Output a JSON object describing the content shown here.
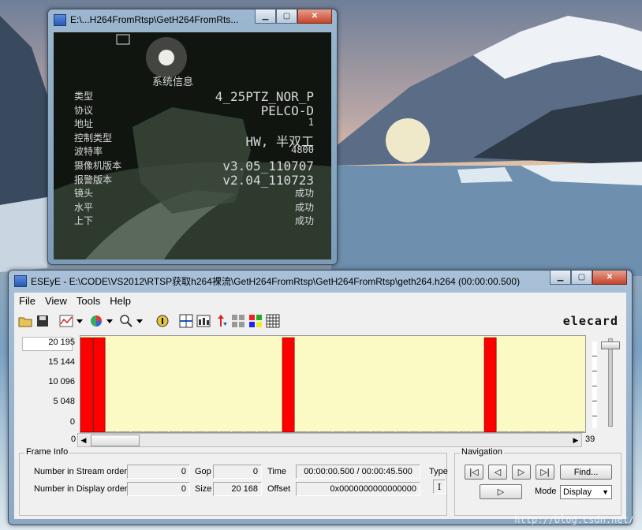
{
  "video_window": {
    "title": "E:\\...H264FromRtsp\\GetH264FromRts...",
    "osd": {
      "header": "系统信息",
      "rows": [
        {
          "label": "类型",
          "value": "4_25PTZ_NOR_P"
        },
        {
          "label": "协议",
          "value": "PELCO-D"
        },
        {
          "label": "地址",
          "value": "1"
        },
        {
          "label": "控制类型",
          "value": "HW, 半双工"
        },
        {
          "label": "波特率",
          "value": "4800"
        },
        {
          "label": "摄像机版本",
          "value": "v3.05_110707"
        },
        {
          "label": "报警版本",
          "value": "v2.04_110723"
        },
        {
          "label": "镜头",
          "value": "成功"
        },
        {
          "label": "水平",
          "value": "成功"
        },
        {
          "label": "上下",
          "value": "成功"
        }
      ]
    }
  },
  "eseye": {
    "title": "ESEyE - E:\\CODE\\VS2012\\RTSP获取h264裸流\\GetH264FromRtsp\\GetH264FromRtsp\\geth264.h264 (00:00:00.500)",
    "menu": [
      "File",
      "View",
      "Tools",
      "Help"
    ],
    "logo": "elecard",
    "chart_data": {
      "type": "bar",
      "y_ticks": [
        "20 195",
        "15 144",
        "10 096",
        "5 048",
        "0"
      ],
      "ylim": [
        0,
        20195
      ],
      "x_start": "0",
      "x_end": "39",
      "bar_color": "#ff0000",
      "values": [
        20168,
        20168,
        100,
        100,
        100,
        100,
        100,
        100,
        100,
        100,
        100,
        100,
        100,
        100,
        100,
        100,
        20168,
        100,
        100,
        100,
        100,
        100,
        100,
        100,
        100,
        100,
        100,
        100,
        100,
        100,
        100,
        100,
        20168,
        100,
        100,
        100,
        100,
        100,
        100,
        100
      ]
    },
    "frame_info": {
      "group_label": "Frame Info",
      "stream_order_label": "Number in Stream order",
      "stream_order": "0",
      "display_order_label": "Number in Display order",
      "display_order": "0",
      "gop_label": "Gop",
      "gop": "0",
      "size_label": "Size",
      "size": "20 168",
      "time_label": "Time",
      "time": "00:00:00.500 / 00:00:45.500",
      "offset_label": "Offset",
      "offset": "0x0000000000000000",
      "type_label": "Type",
      "type": "I"
    },
    "navigation": {
      "group_label": "Navigation",
      "find_label": "Find...",
      "mode_label": "Mode",
      "mode_value": "Display"
    }
  },
  "watermark": "http://blog.csdn.net/"
}
